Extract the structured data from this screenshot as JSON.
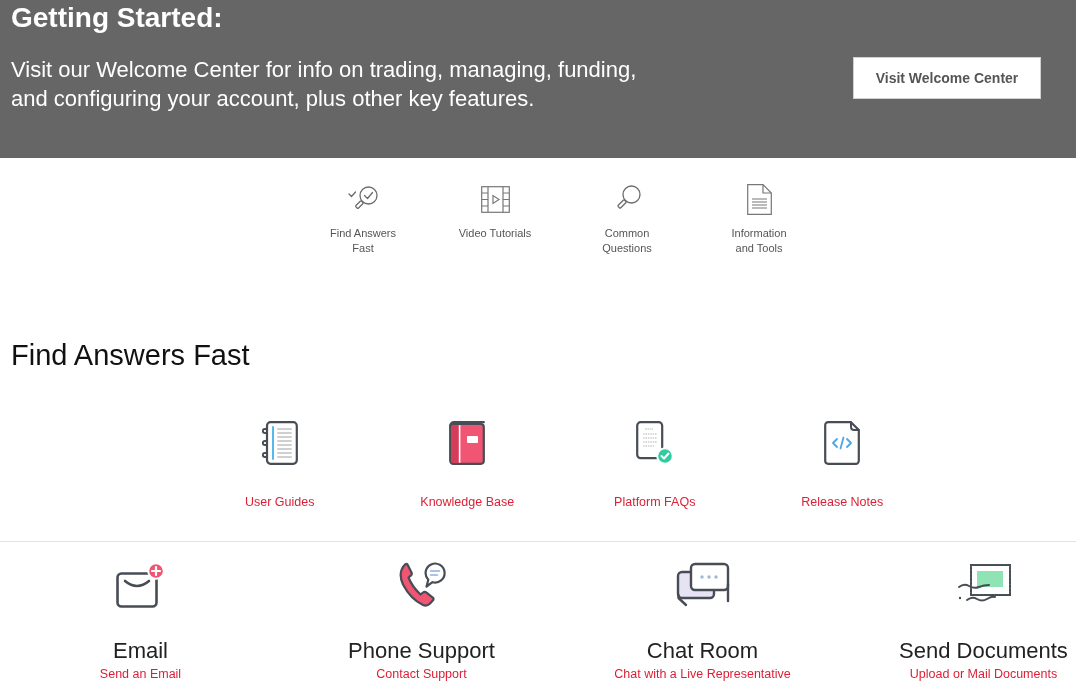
{
  "banner": {
    "title": "Getting Started:",
    "text": "Visit our Welcome Center for info on trading, managing, funding, and configuring your account, plus other key features.",
    "button": "Visit Welcome Center"
  },
  "nav_links": [
    {
      "label": "Find Answers\nFast"
    },
    {
      "label": "Video Tutorials"
    },
    {
      "label": "Common\nQuestions"
    },
    {
      "label": "Information\nand Tools"
    }
  ],
  "find_answers": {
    "heading": "Find Answers Fast",
    "resources": [
      {
        "label": "User Guides"
      },
      {
        "label": "Knowledge Base"
      },
      {
        "label": "Platform FAQs"
      },
      {
        "label": "Release Notes"
      }
    ]
  },
  "contact_options": [
    {
      "title": "Email",
      "link": "Send an Email"
    },
    {
      "title": "Phone Support",
      "link": "Contact Support"
    },
    {
      "title": "Chat Room",
      "link": "Chat with a Live Representative"
    },
    {
      "title": "Send Documents",
      "link": "Upload or Mail Documents"
    }
  ]
}
